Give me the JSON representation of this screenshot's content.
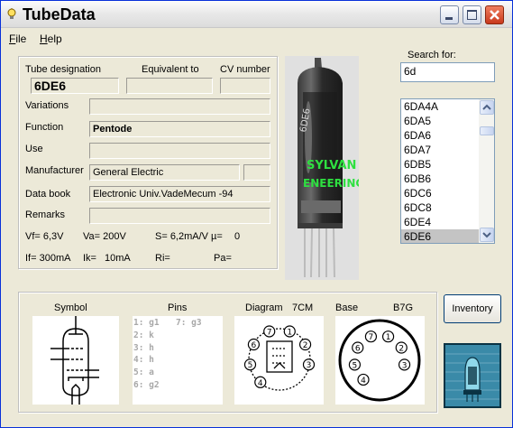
{
  "window": {
    "title": "TubeData"
  },
  "menu": [
    {
      "label": "File",
      "u": "F",
      "rest": "ile"
    },
    {
      "label": "Help",
      "u": "H",
      "rest": "elp"
    }
  ],
  "header": {
    "tube_label": "Tube designation",
    "equiv_label": "Equivalent to",
    "cv_label": "CV number"
  },
  "fields": {
    "tube_designation": "6DE6",
    "equivalent": "",
    "cv_number": "",
    "variations_label": "Variations",
    "variations": "",
    "function_label": "Function",
    "function": "Pentode",
    "use_label": "Use",
    "use": "",
    "manufacturer_label": "Manufacturer",
    "manufacturer": "General Electric",
    "manufacturer_extra": "",
    "databook_label": "Data book",
    "databook": "Electronic Univ.VadeMecum -94",
    "remarks_label": "Remarks",
    "remarks": ""
  },
  "params": {
    "vf": "Vf= 6,3V",
    "va": "Va= 200V",
    "s": "S= 6,2mA/V",
    "mu": "µ=",
    "mu_val": "0",
    "if": "If= 300mA",
    "ik": "Ik=",
    "ik_val": "10mA",
    "ri": "Ri=",
    "pa": "Pa="
  },
  "search": {
    "label": "Search for:",
    "value": "6d"
  },
  "tube_list": {
    "items": [
      "6DA4A",
      "6DA5",
      "6DA6",
      "6DA7",
      "6DB5",
      "6DB6",
      "6DC6",
      "6DC8",
      "6DE4",
      "6DE6"
    ],
    "selected_index": 9
  },
  "bottom": {
    "symbol_label": "Symbol",
    "pins_label": "Pins",
    "diagram_label": "Diagram",
    "diagram_code": "7CM",
    "base_label": "Base",
    "base_code": "B7G",
    "pins": [
      {
        "text": "1: g1",
        "col": 0
      },
      {
        "text": "7: g3",
        "col": 1
      },
      {
        "text": "2: k",
        "col": 0
      },
      {
        "text": "3: h",
        "col": 0
      },
      {
        "text": "4: h",
        "col": 0
      },
      {
        "text": "5: a",
        "col": 0
      },
      {
        "text": "6: g2",
        "col": 0
      }
    ]
  },
  "inventory_button": "Inventory",
  "photo_text": {
    "brand_line1": "SYLVAN",
    "brand_line2": "ENEERINGS",
    "code": "6DE6"
  },
  "colors": {
    "photo_print": "#2ee040"
  }
}
